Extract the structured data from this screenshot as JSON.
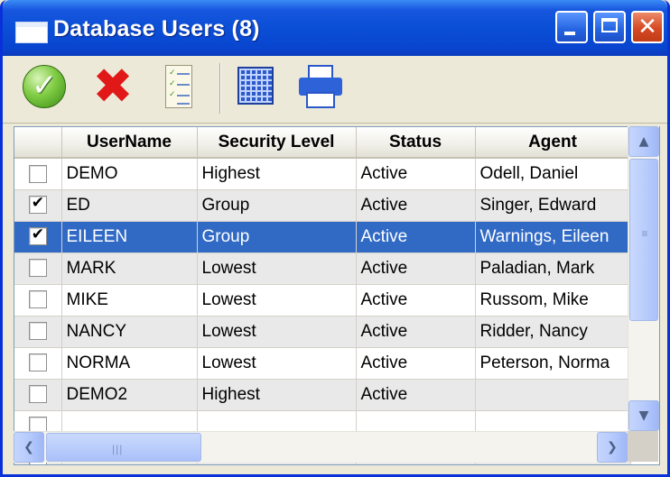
{
  "window": {
    "title": "Database Users (8)",
    "title_icon": "window-icon",
    "controls": {
      "minimize": "minimize",
      "maximize": "maximize",
      "close": "✕"
    }
  },
  "toolbar": {
    "buttons": [
      {
        "name": "ok",
        "icon": "check-circle-icon"
      },
      {
        "name": "delete",
        "icon": "red-x-icon"
      },
      {
        "name": "checklist",
        "icon": "checklist-icon"
      },
      {
        "name": "grid",
        "icon": "grid-icon"
      },
      {
        "name": "print",
        "icon": "printer-icon"
      }
    ]
  },
  "grid": {
    "columns": [
      "",
      "UserName",
      "Security Level",
      "Status",
      "Agent"
    ],
    "rows": [
      {
        "checked": false,
        "username": "DEMO",
        "security": "Highest",
        "status": "Active",
        "agent": "Odell, Daniel"
      },
      {
        "checked": true,
        "username": "ED",
        "security": "Group",
        "status": "Active",
        "agent": "Singer, Edward"
      },
      {
        "checked": true,
        "username": "EILEEN",
        "security": "Group",
        "status": "Active",
        "agent": "Warnings, Eileen",
        "selected": true
      },
      {
        "checked": false,
        "username": "MARK",
        "security": "Lowest",
        "status": "Active",
        "agent": "Paladian, Mark"
      },
      {
        "checked": false,
        "username": "MIKE",
        "security": "Lowest",
        "status": "Active",
        "agent": "Russom, Mike"
      },
      {
        "checked": false,
        "username": "NANCY",
        "security": "Lowest",
        "status": "Active",
        "agent": "Ridder, Nancy"
      },
      {
        "checked": false,
        "username": "NORMA",
        "security": "Lowest",
        "status": "Active",
        "agent": "Peterson, Norma"
      },
      {
        "checked": false,
        "username": "DEMO2",
        "security": "Highest",
        "status": "Active",
        "agent": ""
      },
      {
        "checked": false,
        "username": "",
        "security": "",
        "status": "",
        "agent": ""
      },
      {
        "checked": false,
        "username": "",
        "security": "",
        "status": "",
        "agent": ""
      }
    ]
  },
  "scrollbars": {
    "up": "▲",
    "down": "▼",
    "left": "❮",
    "right": "❯"
  },
  "colors": {
    "selection": "#316ac5",
    "titlebar": "#0a4fd6",
    "alt_row": "#e9e9e9"
  }
}
